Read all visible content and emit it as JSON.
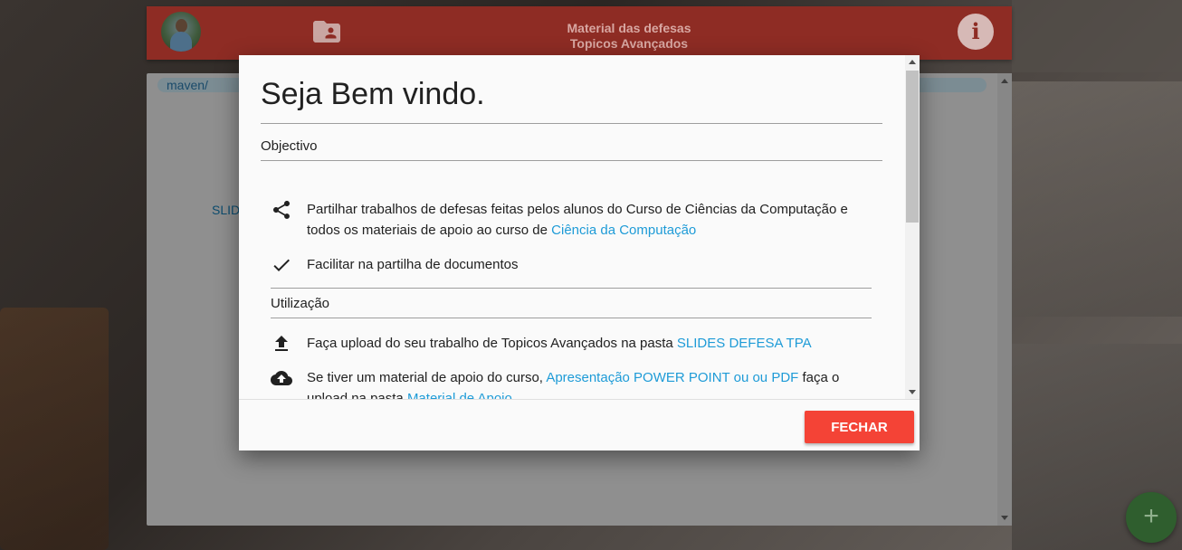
{
  "header": {
    "title_line1": "Material das defesas",
    "title_line2": "Topicos Avançados",
    "info_glyph": "i"
  },
  "panel": {
    "breadcrumb": "maven/",
    "partial_link": "SLID"
  },
  "fab_glyph": "+",
  "dialog": {
    "title": "Seja Bem vindo.",
    "section_objective": "Objectivo",
    "section_usage": "Utilização",
    "items_objective": [
      {
        "icon": "share-icon",
        "text_before": "Partilhar trabalhos de defesas feitas pelos alunos do Curso de Ciências da Computação e todos os materiais de apoio ao curso de ",
        "link": "Ciência da Computação",
        "text_after": ""
      },
      {
        "icon": "check-icon",
        "text_before": "Facilitar na partilha de documentos",
        "link": "",
        "text_after": ""
      }
    ],
    "items_usage": [
      {
        "icon": "upload-icon",
        "text_before": "Faça upload do seu trabalho de Topicos Avançados na pasta ",
        "link": "SLIDES DEFESA TPA",
        "text_after": ""
      },
      {
        "icon": "cloud-upload-icon",
        "text_before": "Se tiver um material de apoio do curso, ",
        "link": "Apresentação POWER POINT ou ou PDF",
        "text_after": " faça o upload na pasta ",
        "link2": "Material de Apoio"
      }
    ],
    "close_label": "FECHAR"
  },
  "colors": {
    "appbar": "#8e2c24",
    "close_button": "#f44336",
    "link": "#1e9bd7",
    "fab": "#2f5e2e"
  }
}
